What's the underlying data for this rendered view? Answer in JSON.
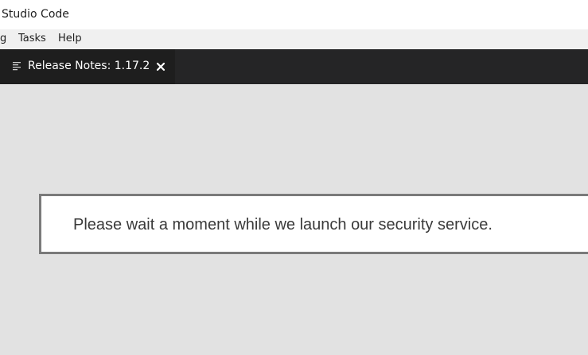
{
  "window": {
    "title": "Studio Code"
  },
  "menubar": {
    "items": [
      "g",
      "Tasks",
      "Help"
    ]
  },
  "tabs": [
    {
      "label": "Release Notes: 1.17.2",
      "icon": "preview-icon",
      "active": true
    }
  ],
  "notice": {
    "message": "Please wait a moment while we launch our security service."
  },
  "colors": {
    "titlebar_bg": "#ffffff",
    "menubar_bg": "#f0f0f0",
    "tabbar_bg": "#252526",
    "active_tab_bg": "#1e1e1e",
    "editor_bg": "#e2e2e2",
    "notice_border": "#7a7a7a"
  }
}
